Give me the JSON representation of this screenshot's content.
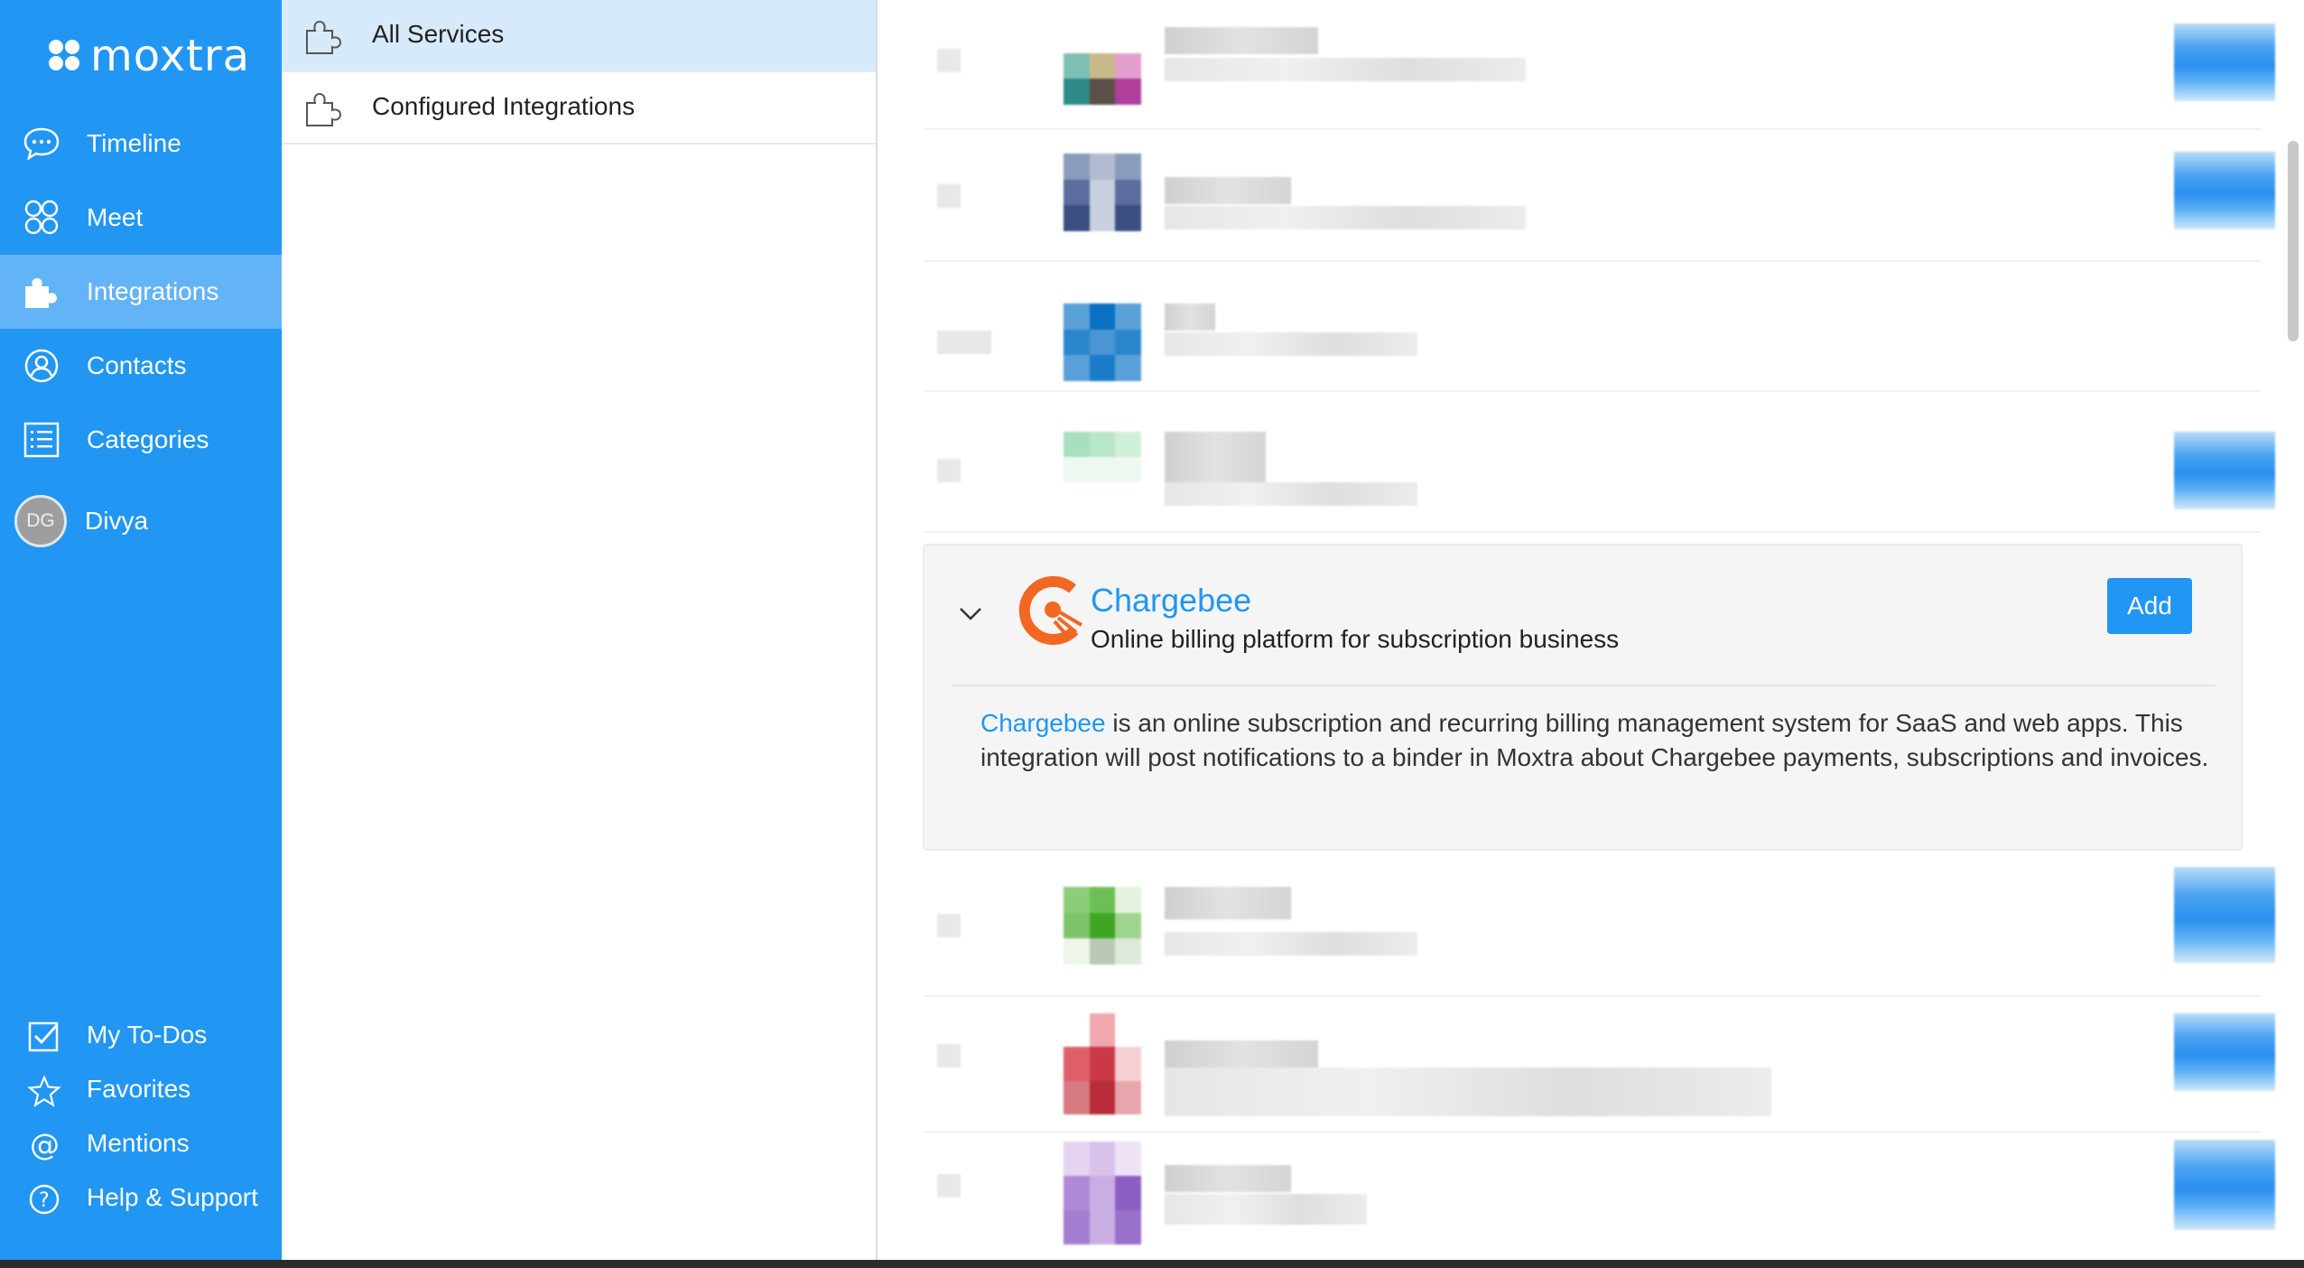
{
  "brand": {
    "name": "moxtra"
  },
  "sidebar": {
    "nav": [
      {
        "label": "Timeline",
        "icon": "chat-bubble-icon"
      },
      {
        "label": "Meet",
        "icon": "meet-circles-icon"
      },
      {
        "label": "Integrations",
        "icon": "puzzle-icon",
        "active": true
      },
      {
        "label": "Contacts",
        "icon": "contact-icon"
      },
      {
        "label": "Categories",
        "icon": "list-icon"
      }
    ],
    "user": {
      "initials": "DG",
      "name": "Divya"
    },
    "bottom": [
      {
        "label": "My To-Dos",
        "icon": "checkbox-icon"
      },
      {
        "label": "Favorites",
        "icon": "star-icon"
      },
      {
        "label": "Mentions",
        "icon": "at-icon"
      },
      {
        "label": "Help & Support",
        "icon": "help-icon"
      }
    ]
  },
  "midpanel": {
    "items": [
      {
        "label": "All Services",
        "icon": "puzzle-outline-icon",
        "active": true
      },
      {
        "label": "Configured Integrations",
        "icon": "puzzle-outline-icon"
      }
    ]
  },
  "expanded_service": {
    "name": "Chargebee",
    "tagline": "Online billing platform for subscription business",
    "add_label": "Add",
    "description_link": "Chargebee",
    "description_rest": " is an online subscription and recurring billing management system for SaaS and web apps. This integration will post notifications to a binder in Moxtra about Chargebee payments, subscriptions and invoices."
  },
  "colors": {
    "accent": "#2196f3",
    "active_nav": "#63b3f7",
    "chargebee": "#f26822"
  }
}
